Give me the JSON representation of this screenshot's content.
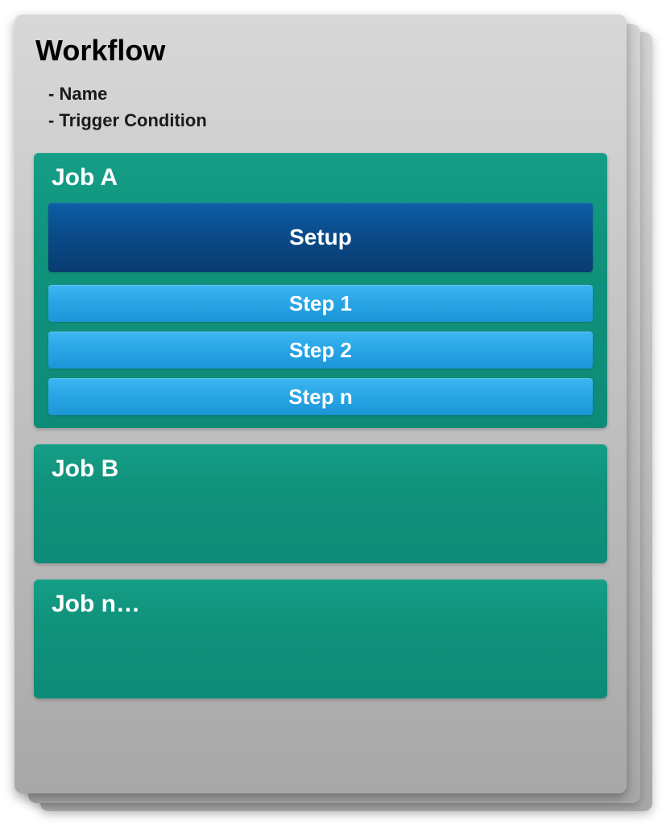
{
  "workflow": {
    "title": "Workflow",
    "attributes": [
      "Name",
      "Trigger Condition"
    ]
  },
  "jobs": [
    {
      "id": "job-a",
      "title": "Job A",
      "setup": "Setup",
      "steps": [
        "Step 1",
        "Step 2",
        "Step n"
      ]
    },
    {
      "id": "job-b",
      "title": "Job B",
      "setup": null,
      "steps": []
    },
    {
      "id": "job-n",
      "title": "Job n…",
      "setup": null,
      "steps": []
    }
  ],
  "colors": {
    "card_gradient_top": "#d8d8d8",
    "card_gradient_bottom": "#a8a8a8",
    "job_teal": "#119381",
    "setup_dark_blue": "#0a4b89",
    "step_light_blue": "#2aa6e6"
  }
}
